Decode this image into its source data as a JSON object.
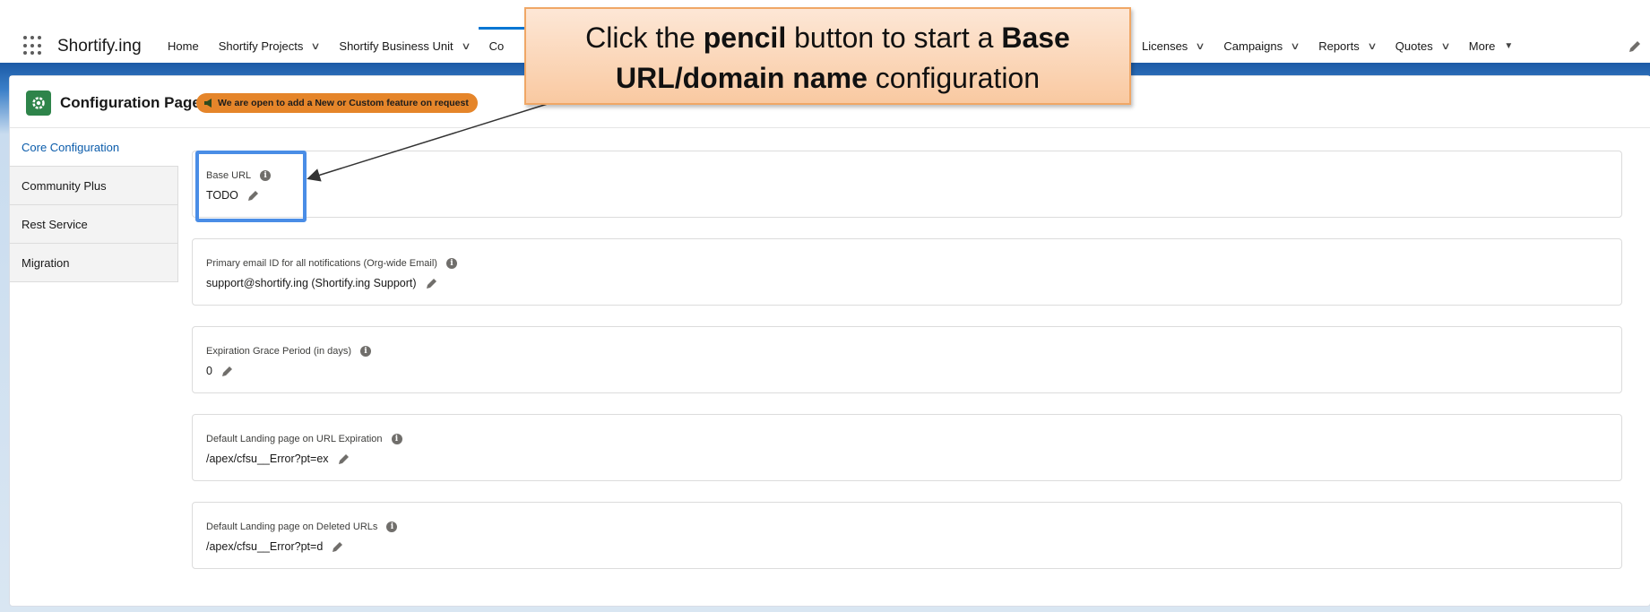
{
  "app": {
    "name": "Shortify.ing"
  },
  "nav": {
    "left_items": [
      {
        "label": "Home",
        "has_chevron": false
      },
      {
        "label": "Shortify Projects",
        "has_chevron": true
      },
      {
        "label": "Shortify Business Unit",
        "has_chevron": true
      },
      {
        "label": "Co",
        "has_chevron": false,
        "active": true
      }
    ],
    "right_items": [
      {
        "label": "Licenses",
        "has_chevron": true
      },
      {
        "label": "Campaigns",
        "has_chevron": true
      },
      {
        "label": "Reports",
        "has_chevron": true
      },
      {
        "label": "Quotes",
        "has_chevron": true
      }
    ],
    "more_label": "More",
    "chevron_glyph": "∨",
    "caret_glyph": "▼"
  },
  "page": {
    "title": "Configuration Page",
    "icon": "gear-icon",
    "promo_badge": "We are open to add a New or Custom feature on request",
    "promo_icon": "megaphone-icon"
  },
  "side_tabs": [
    {
      "label": "Core Configuration",
      "active": true
    },
    {
      "label": "Community Plus",
      "active": false
    },
    {
      "label": "Rest Service",
      "active": false
    },
    {
      "label": "Migration",
      "active": false
    }
  ],
  "fields": [
    {
      "label": "Base URL",
      "value": "TODO"
    },
    {
      "label": "Primary email ID for all notifications (Org-wide Email)",
      "value": "support@shortify.ing (Shortify.ing Support)"
    },
    {
      "label": "Expiration Grace Period (in days)",
      "value": "0"
    },
    {
      "label": "Default Landing page on URL Expiration",
      "value": "/apex/cfsu__Error?pt=ex"
    },
    {
      "label": "Default Landing page on Deleted URLs",
      "value": "/apex/cfsu__Error?pt=d"
    }
  ],
  "callout": {
    "text_1": "Click the ",
    "bold_1": "pencil",
    "text_2": " button to start a ",
    "bold_2": "Base URL/domain name",
    "text_3": " configuration"
  },
  "colors": {
    "accent": "#0176d3",
    "page_icon_bg": "#2e844a",
    "badge_bg": "#e5852a",
    "highlight": "#4a8de6",
    "callout_border": "#f0a766"
  }
}
